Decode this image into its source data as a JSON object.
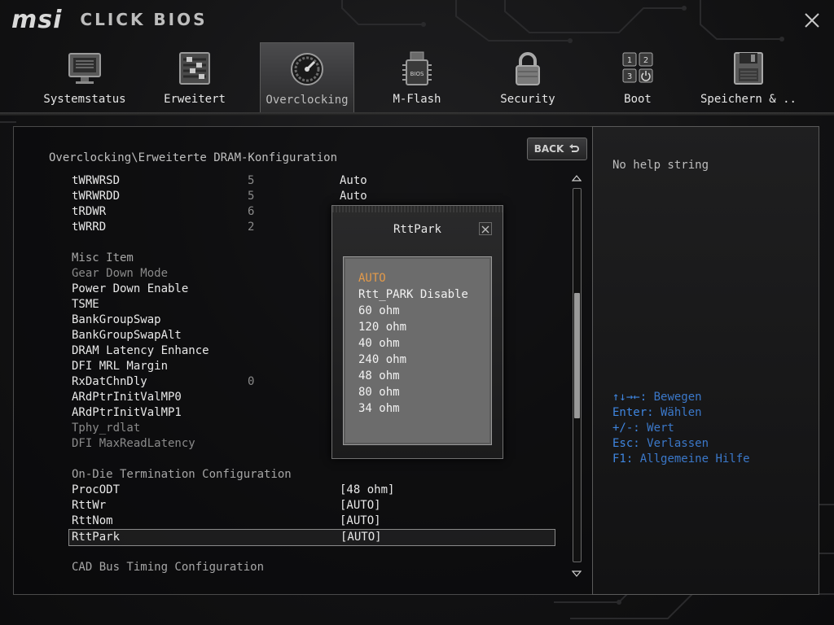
{
  "logo": {
    "brand": "msi",
    "product": "CLICK BIOS"
  },
  "colors": {
    "accent_orange": "#e39a4a",
    "help_blue": "#3b78c9",
    "text": "#e8e8e8",
    "dim": "#8a8a8a"
  },
  "nav": {
    "tabs": [
      {
        "label": "Systemstatus",
        "icon": "monitor-icon"
      },
      {
        "label": "Erweitert",
        "icon": "sliders-icon"
      },
      {
        "label": "Overclocking",
        "icon": "speedometer-icon",
        "active": true
      },
      {
        "label": "M-Flash",
        "icon": "bios-chip-icon"
      },
      {
        "label": "Security",
        "icon": "padlock-icon"
      },
      {
        "label": "Boot",
        "icon": "boot-order-icon"
      },
      {
        "label": "Speichern & ..",
        "icon": "floppy-icon"
      }
    ]
  },
  "main": {
    "breadcrumb": "Overclocking\\Erweiterte DRAM-Konfiguration",
    "back_label": "BACK",
    "rows": [
      {
        "name": "tWRWRSD",
        "num": "5",
        "value": "Auto"
      },
      {
        "name": "tWRWRDD",
        "num": "5",
        "value": "Auto"
      },
      {
        "name": "tRDWR",
        "num": "6",
        "value": ""
      },
      {
        "name": "tWRRD",
        "num": "2",
        "value": ""
      },
      {
        "name": "Misc Item",
        "num": "",
        "value": ""
      },
      {
        "name": "Gear Down Mode",
        "num": "",
        "value": ""
      },
      {
        "name": "Power Down Enable",
        "num": "",
        "value": ""
      },
      {
        "name": "TSME",
        "num": "",
        "value": ""
      },
      {
        "name": "BankGroupSwap",
        "num": "",
        "value": ""
      },
      {
        "name": "BankGroupSwapAlt",
        "num": "",
        "value": ""
      },
      {
        "name": "DRAM Latency Enhance",
        "num": "",
        "value": ""
      },
      {
        "name": "DFI MRL Margin",
        "num": "",
        "value": ""
      },
      {
        "name": "RxDatChnDly",
        "num": "0",
        "value": ""
      },
      {
        "name": "ARdPtrInitValMP0",
        "num": "",
        "value": ""
      },
      {
        "name": "ARdPtrInitValMP1",
        "num": "",
        "value": ""
      },
      {
        "name": "Tphy_rdlat",
        "num": "",
        "value": ""
      },
      {
        "name": "DFI MaxReadLatency",
        "num": "",
        "value": ""
      },
      {
        "name": "On-Die Termination Configuration",
        "num": "",
        "value": ""
      },
      {
        "name": "ProcODT",
        "num": "",
        "value": "[48 ohm]"
      },
      {
        "name": "RttWr",
        "num": "",
        "value": "[AUTO]"
      },
      {
        "name": "RttNom",
        "num": "",
        "value": "[AUTO]"
      },
      {
        "name": "RttPark",
        "num": "",
        "value": "[AUTO]"
      },
      {
        "name": "CAD Bus Timing Configuration",
        "num": "",
        "value": ""
      }
    ],
    "scroll_position": 0.42
  },
  "popup": {
    "title": "RttPark",
    "options": [
      "AUTO",
      "Rtt_PARK Disable",
      "60 ohm",
      "120 ohm",
      "40 ohm",
      "240 ohm",
      "48 ohm",
      "80 ohm",
      "34 ohm"
    ],
    "selected_index": 0
  },
  "help": {
    "text": "No help string",
    "keys": [
      {
        "key": "↑↓→←:",
        "desc": " Bewegen"
      },
      {
        "key": "Enter:",
        "desc": " Wählen"
      },
      {
        "key": "+/-:",
        "desc": " Wert"
      },
      {
        "key": "Esc:",
        "desc": " Verlassen"
      },
      {
        "key": "F1:",
        "desc": " Allgemeine Hilfe"
      }
    ]
  }
}
